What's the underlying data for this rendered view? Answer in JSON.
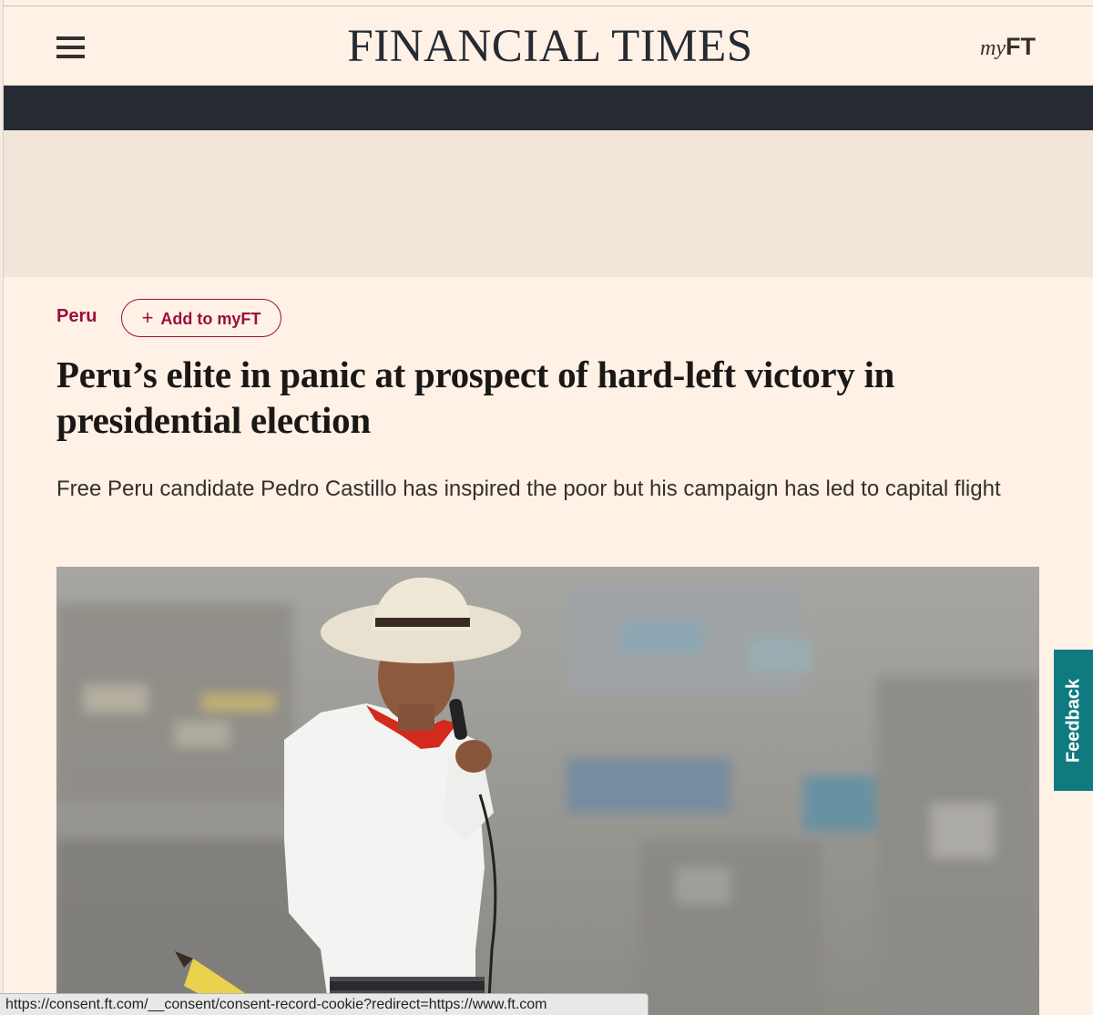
{
  "header": {
    "masthead": "FINANCIAL TIMES",
    "myft_my": "my",
    "myft_ft": "FT",
    "menu_icon": "hamburger-menu-icon"
  },
  "article": {
    "topic": "Peru",
    "add_to_myft_plus": "+",
    "add_to_myft": "Add to myFT",
    "headline": "Peru’s elite in panic at prospect of hard-left victory in presidential election",
    "standfirst": "Free Peru candidate Pedro Castillo has inspired the poor but his campaign has led to capital flight"
  },
  "feedback": {
    "label": "Feedback"
  },
  "status_bar": {
    "url": "https://consent.ft.com/__consent/consent-record-cookie?redirect=https://www.ft.com"
  },
  "colors": {
    "page_background": "#fff1e5",
    "navbar": "#262a33",
    "ad_slot": "#f2e5da",
    "claret": "#990f3d",
    "feedback_teal": "#0f7a80"
  }
}
